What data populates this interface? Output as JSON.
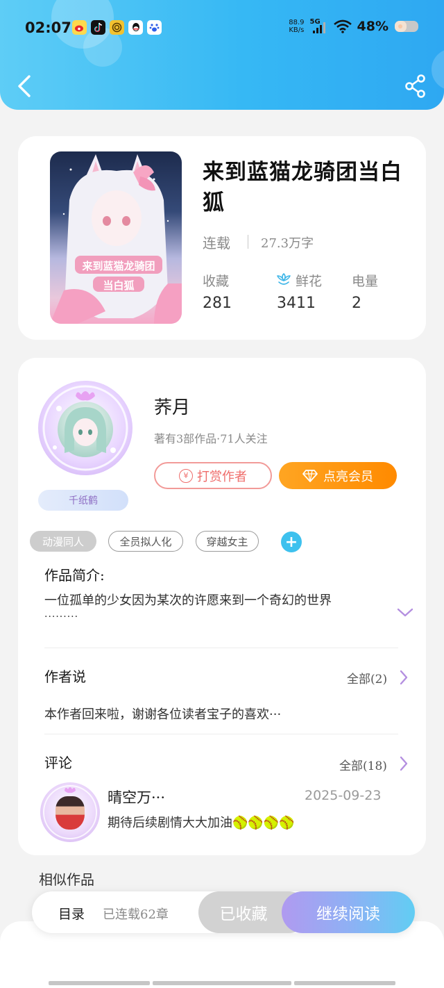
{
  "status_bar": {
    "time": "02:07",
    "net_speed_value": "88.9",
    "net_speed_unit": "KB/s",
    "network": "5G",
    "battery": "48%",
    "app_icons": [
      "weibo-icon",
      "tiktok-icon",
      "spiral-app-icon",
      "qq-icon",
      "baidu-icon"
    ]
  },
  "header": {
    "back_icon": "chevron-left-icon",
    "share_icon": "share-icon",
    "colors": {
      "gradient_start": "#5ecdf6",
      "gradient_end": "#2ea8f2"
    }
  },
  "book": {
    "title": "来到蓝猫龙骑团当白狐",
    "status": "连载",
    "word_count": "27.3万字",
    "cover_text_line1": "来到蓝猫龙骑团",
    "cover_text_line2": "当白狐",
    "stats": [
      {
        "label": "收藏",
        "value": "281"
      },
      {
        "label": "鲜花",
        "value": "3411"
      },
      {
        "label": "电量",
        "value": "2"
      }
    ]
  },
  "author": {
    "name": "荞月",
    "meta": "著有3部作品·71人关注",
    "badge": "千纸鹤",
    "tip_button": "打赏作者",
    "tip_icon_text": "¥",
    "vip_button": "点亮会员"
  },
  "tags": {
    "items": [
      "动漫同人",
      "全员拟人化",
      "穿越女主"
    ],
    "add_label": "+"
  },
  "intro": {
    "title": "作品简介:",
    "text": "一位孤单的少女因为某次的许愿来到一个奇幻的世界",
    "ellipsis": "·········"
  },
  "author_says": {
    "title": "作者说",
    "all_label": "全部(2)",
    "text": "本作者回来啦，谢谢各位读者宝子的喜欢···"
  },
  "comments": {
    "title": "评论",
    "all_label": "全部(18)",
    "items": [
      {
        "name": "晴空万···",
        "date": "2025-09-23",
        "text": "期待后续剧情大大加油🥎🥎🥎🥎"
      }
    ]
  },
  "similar": {
    "title": "相似作品"
  },
  "bottom_bar": {
    "toc_label": "目录",
    "toc_count": "已连载62章",
    "collected_label": "已收藏",
    "read_label": "继续阅读",
    "colors": {
      "collected_bg": "#d2d2d2",
      "read_start": "#b09af0",
      "read_end": "#61cdf3"
    }
  }
}
